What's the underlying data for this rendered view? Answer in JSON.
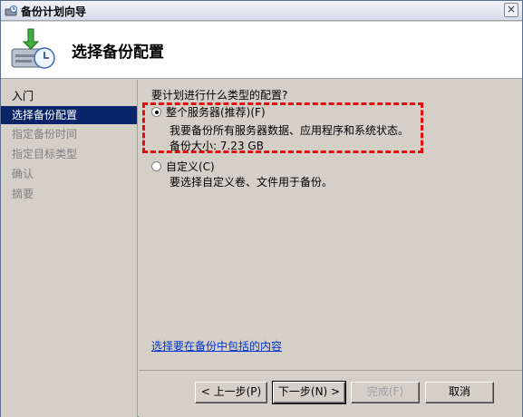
{
  "window": {
    "title": "备份计划向导",
    "close_label": "×"
  },
  "header": {
    "title": "选择备份配置"
  },
  "nav": {
    "items": [
      {
        "label": "入门",
        "state": "done"
      },
      {
        "label": "选择备份配置",
        "state": "active"
      },
      {
        "label": "指定备份时间",
        "state": "pending"
      },
      {
        "label": "指定目标类型",
        "state": "pending"
      },
      {
        "label": "确认",
        "state": "pending"
      },
      {
        "label": "摘要",
        "state": "pending"
      }
    ]
  },
  "main": {
    "question": "要计划进行什么类型的配置?",
    "options": [
      {
        "label": "整个服务器(推荐)(F)",
        "checked": true,
        "description": "我要备份所有服务器数据、应用程序和系统状态。",
        "size_text": "备份大小: 7.23 GB"
      },
      {
        "label": "自定义(C)",
        "checked": false,
        "description": "要选择自定义卷、文件用于备份。"
      }
    ],
    "link": "选择要在备份中包括的内容"
  },
  "buttons": {
    "back": "< 上一步(P)",
    "next": "下一步(N) >",
    "finish": "完成(F)",
    "cancel": "取消"
  },
  "colors": {
    "accent_active": "#0a246a",
    "highlight": "#e01010",
    "link": "#0033cc"
  }
}
